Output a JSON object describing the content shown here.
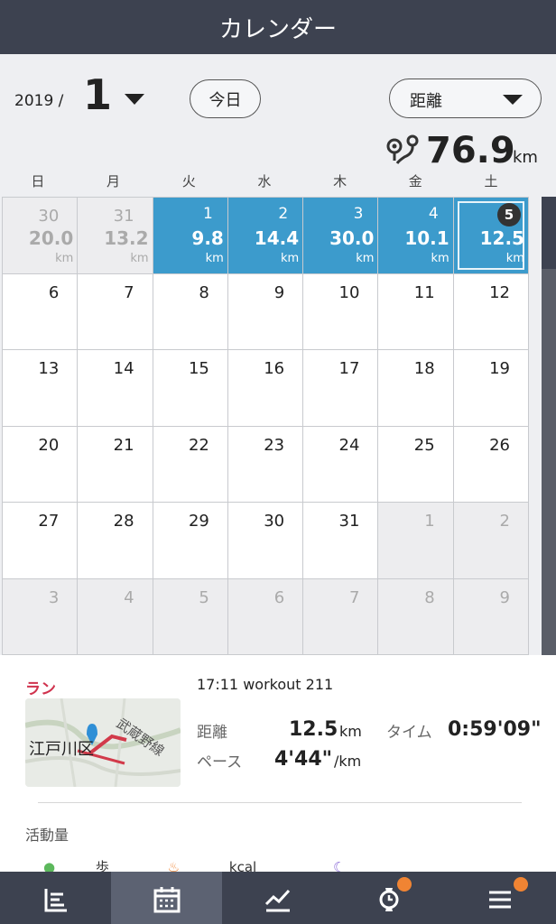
{
  "header": {
    "title": "カレンダー"
  },
  "controls": {
    "year": "2019 /",
    "month": "1",
    "today_label": "今日",
    "metric_label": "距離",
    "total_value": "76.9",
    "total_unit": "km"
  },
  "weekdays": [
    "日",
    "月",
    "火",
    "水",
    "木",
    "金",
    "土"
  ],
  "cells": [
    {
      "day": "30",
      "value": "20.0",
      "unit": "km",
      "state": "other"
    },
    {
      "day": "31",
      "value": "13.2",
      "unit": "km",
      "state": "other"
    },
    {
      "day": "1",
      "value": "9.8",
      "unit": "km",
      "state": "active"
    },
    {
      "day": "2",
      "value": "14.4",
      "unit": "km",
      "state": "active"
    },
    {
      "day": "3",
      "value": "30.0",
      "unit": "km",
      "state": "active"
    },
    {
      "day": "4",
      "value": "10.1",
      "unit": "km",
      "state": "active"
    },
    {
      "day": "5",
      "value": "12.5",
      "unit": "km",
      "state": "selected"
    },
    {
      "day": "6"
    },
    {
      "day": "7"
    },
    {
      "day": "8"
    },
    {
      "day": "9"
    },
    {
      "day": "10"
    },
    {
      "day": "11"
    },
    {
      "day": "12"
    },
    {
      "day": "13"
    },
    {
      "day": "14"
    },
    {
      "day": "15"
    },
    {
      "day": "16"
    },
    {
      "day": "17"
    },
    {
      "day": "18"
    },
    {
      "day": "19"
    },
    {
      "day": "20"
    },
    {
      "day": "21"
    },
    {
      "day": "22"
    },
    {
      "day": "23"
    },
    {
      "day": "24"
    },
    {
      "day": "25"
    },
    {
      "day": "26"
    },
    {
      "day": "27"
    },
    {
      "day": "28"
    },
    {
      "day": "29"
    },
    {
      "day": "30"
    },
    {
      "day": "31"
    },
    {
      "day": "1",
      "state": "other"
    },
    {
      "day": "2",
      "state": "other"
    },
    {
      "day": "3",
      "state": "other"
    },
    {
      "day": "4",
      "state": "other"
    },
    {
      "day": "5",
      "state": "other"
    },
    {
      "day": "6",
      "state": "other"
    },
    {
      "day": "7",
      "state": "other"
    },
    {
      "day": "8",
      "state": "other"
    },
    {
      "day": "9",
      "state": "other"
    }
  ],
  "detail": {
    "type_label": "ラン",
    "time_title": "17:11  workout 211",
    "distance_label": "距離",
    "distance_value": "12.5",
    "distance_unit": "km",
    "time_label": "タイム",
    "time_value": "0:59'09\"",
    "pace_label": "ペース",
    "pace_value": "4'44\"",
    "pace_unit": "/km",
    "map_text": "江戸川区",
    "map_rail": "武蔵野線",
    "activity_title": "活動量",
    "steps_unit": "歩",
    "kcal_unit": "kcal"
  },
  "colors": {
    "header": "#3d4250",
    "active_cell": "#3c9bcc",
    "run_accent": "#d0334e",
    "notify_dot": "#f08433"
  }
}
